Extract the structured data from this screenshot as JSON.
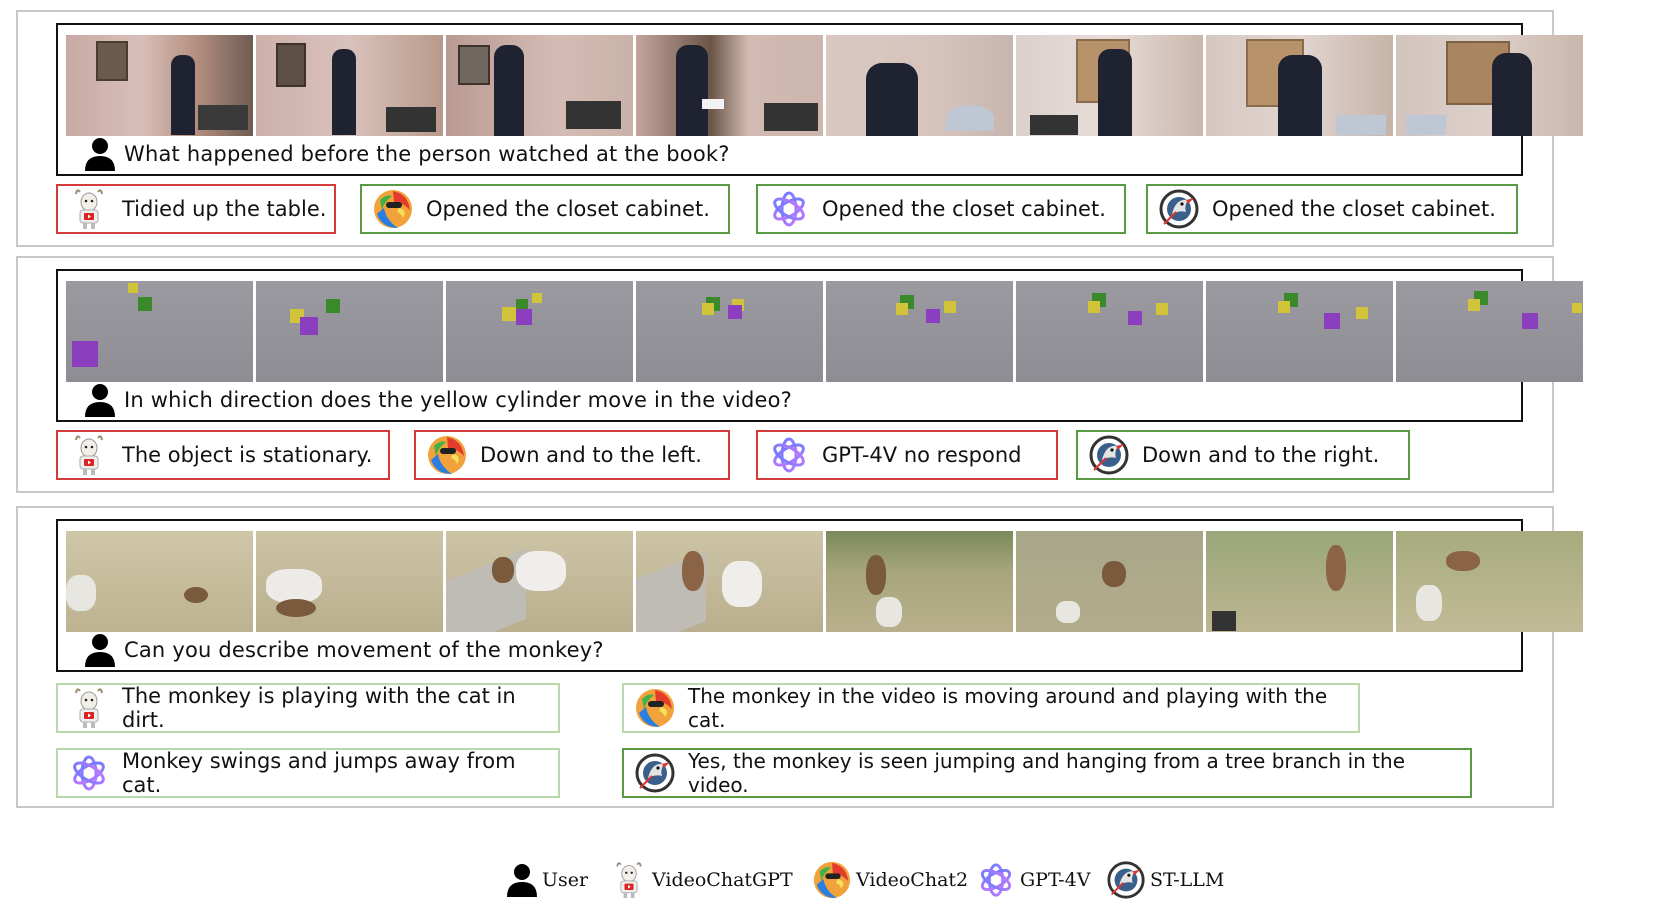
{
  "examples": [
    {
      "question": "What happened before the person watched at the book?",
      "answers": {
        "videochatgpt": "Tidied up the table.",
        "videochat2": "Opened the closet cabinet.",
        "gpt4v": "Opened the closet cabinet.",
        "stllm": "Opened the closet cabinet."
      }
    },
    {
      "question": "In which direction does the yellow cylinder move in the video?",
      "answers": {
        "videochatgpt": "The object is stationary.",
        "videochat2": "Down and to the left.",
        "gpt4v": "GPT-4V no respond",
        "stllm": "Down and to the right."
      }
    },
    {
      "question": "Can you describe movement of the monkey?",
      "answers": {
        "videochatgpt": "The monkey is playing with the cat in dirt.",
        "videochat2": "The monkey in the video is moving around and playing with the cat.",
        "gpt4v": "Monkey swings and jumps away from cat.",
        "stllm": "Yes, the monkey is seen jumping and hanging from a tree branch in the video."
      }
    }
  ],
  "legend": {
    "user": "User",
    "videochatgpt": "VideoChatGPT",
    "videochat2": "VideoChat2",
    "gpt4v": "GPT-4V",
    "stllm": "ST-LLM"
  },
  "colors": {
    "wrong_border": "#d33a3a",
    "correct_border": "#5a9a45",
    "partial_border": "#b9d9ac",
    "panel_border": "#c8c8c8"
  },
  "icons": {
    "user": "person-silhouette-icon",
    "videochatgpt": "goat-mascot-icon",
    "videochat2": "parrot-icon",
    "gpt4v": "openai-knot-icon",
    "stllm": "compass-bird-icon"
  }
}
